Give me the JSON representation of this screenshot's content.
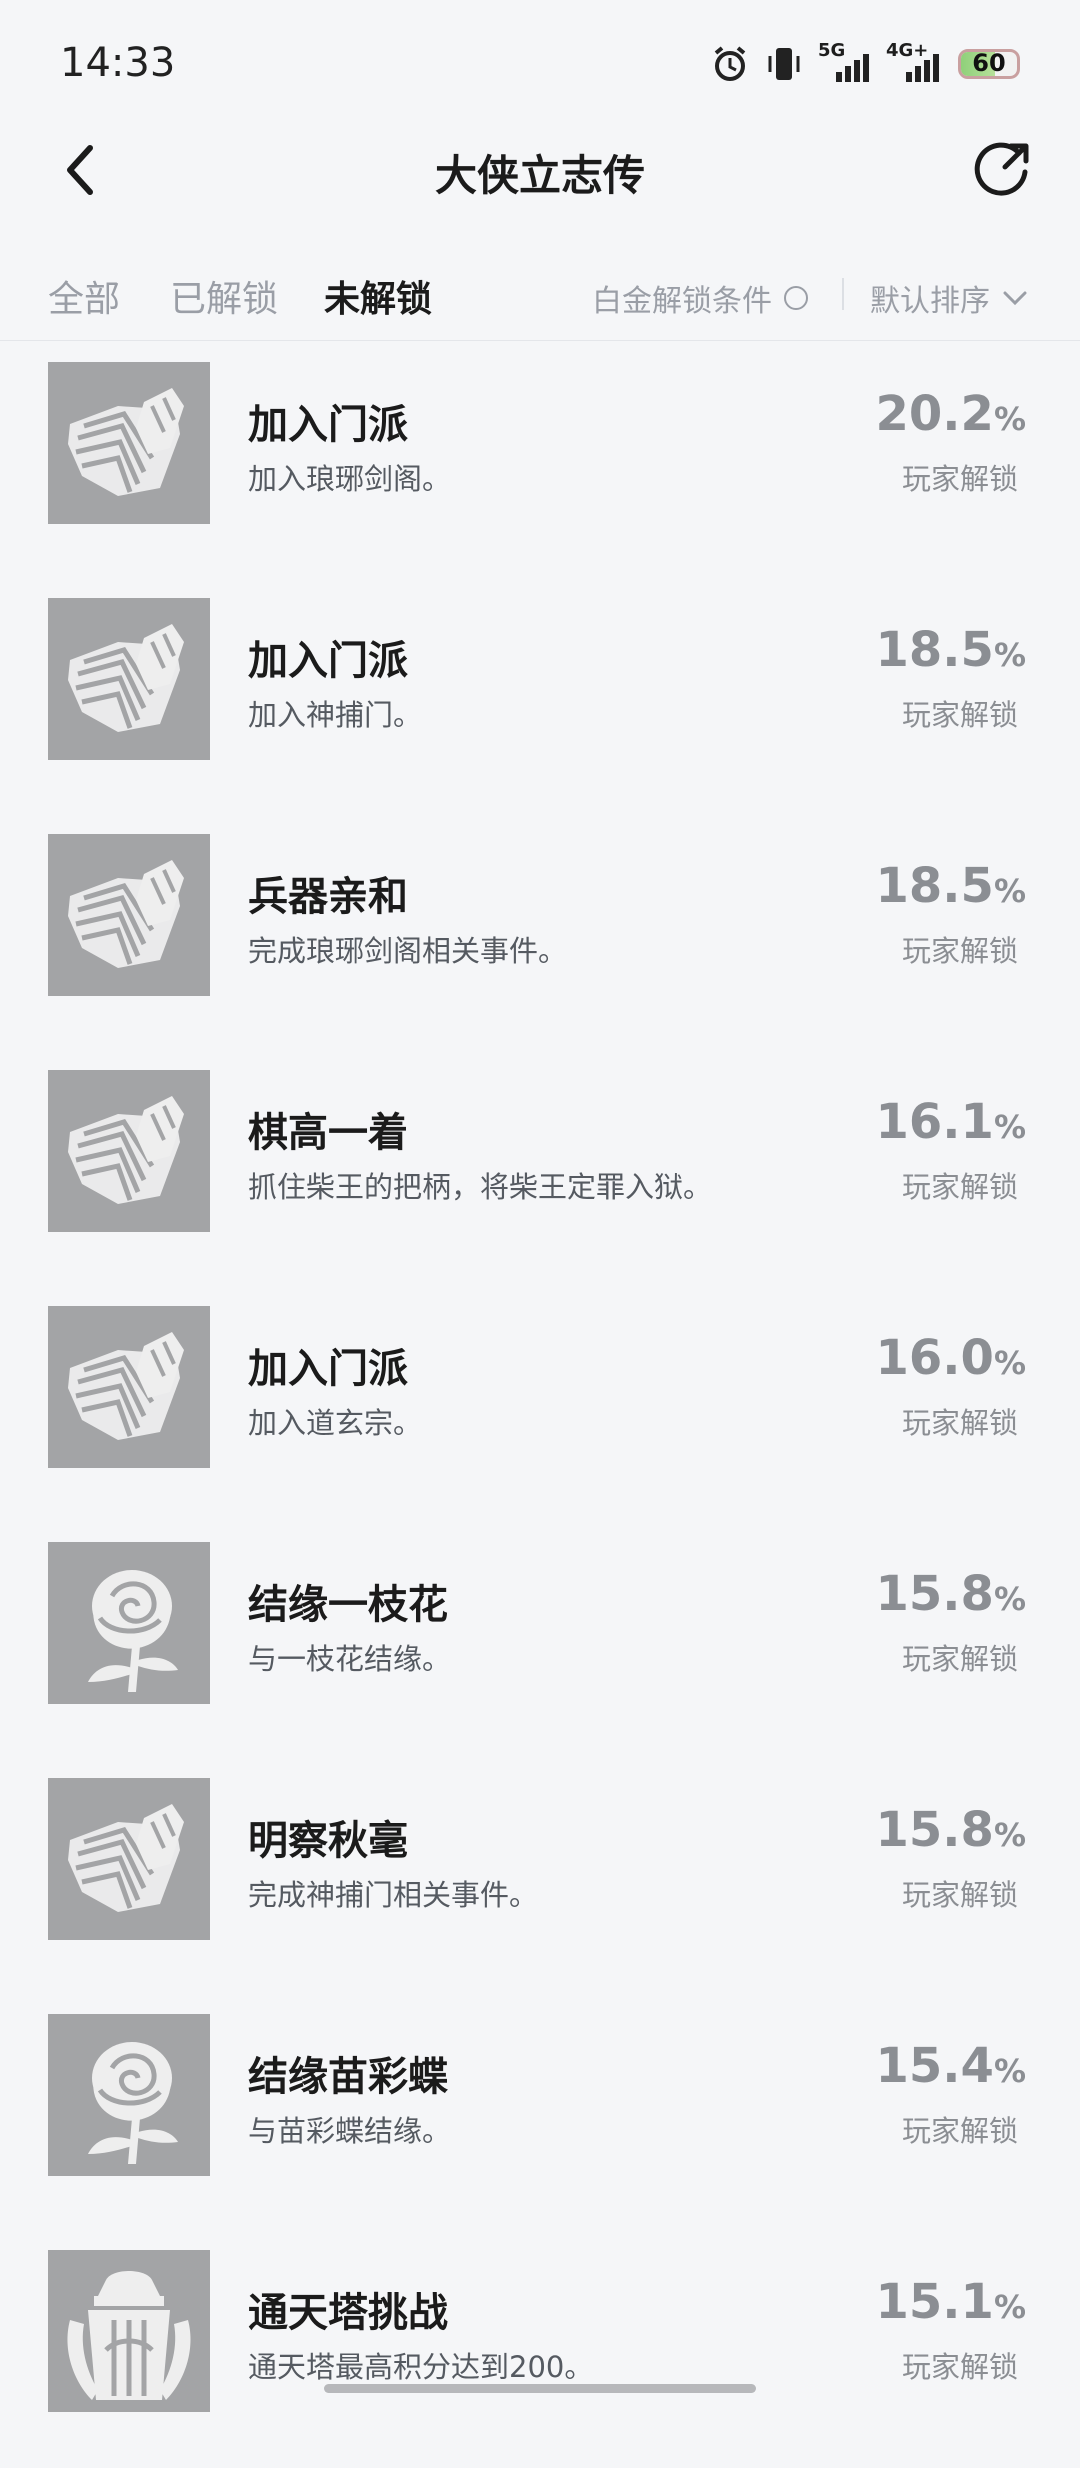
{
  "status": {
    "time": "14:33",
    "network_5g": "5G",
    "network_4g": "4G+",
    "battery": "60",
    "battery_level": 0.6
  },
  "nav": {
    "title": "大侠立志传",
    "back_icon": "chevron-left-icon",
    "share_icon": "share-rotate-icon"
  },
  "tabs": [
    {
      "label": "全部"
    },
    {
      "label": "已解锁"
    },
    {
      "label": "未解锁"
    }
  ],
  "filters": {
    "platinum": "白金解锁条件",
    "sort": "默认排序"
  },
  "items": [
    {
      "title": "加入门派",
      "desc": "加入琅琊剑阁。",
      "percent": "20.2",
      "unit": "%",
      "label": "玩家解锁",
      "icon": "book-icon"
    },
    {
      "title": "加入门派",
      "desc": "加入神捕门。",
      "percent": "18.5",
      "unit": "%",
      "label": "玩家解锁",
      "icon": "book-icon"
    },
    {
      "title": "兵器亲和",
      "desc": "完成琅琊剑阁相关事件。",
      "percent": "18.5",
      "unit": "%",
      "label": "玩家解锁",
      "icon": "book-icon"
    },
    {
      "title": "棋高一着",
      "desc": "抓住柴王的把柄，将柴王定罪入狱。",
      "percent": "16.1",
      "unit": "%",
      "label": "玩家解锁",
      "icon": "book-icon"
    },
    {
      "title": "加入门派",
      "desc": "加入道玄宗。",
      "percent": "16.0",
      "unit": "%",
      "label": "玩家解锁",
      "icon": "book-icon"
    },
    {
      "title": "结缘一枝花",
      "desc": "与一枝花结缘。",
      "percent": "15.8",
      "unit": "%",
      "label": "玩家解锁",
      "icon": "rose-icon"
    },
    {
      "title": "明察秋毫",
      "desc": "完成神捕门相关事件。",
      "percent": "15.8",
      "unit": "%",
      "label": "玩家解锁",
      "icon": "book-icon"
    },
    {
      "title": "结缘苗彩蝶",
      "desc": "与苗彩蝶结缘。",
      "percent": "15.4",
      "unit": "%",
      "label": "玩家解锁",
      "icon": "rose-icon"
    },
    {
      "title": "通天塔挑战",
      "desc": "通天塔最高积分达到200。",
      "percent": "15.1",
      "unit": "%",
      "label": "玩家解锁",
      "icon": "tower-icon"
    }
  ]
}
